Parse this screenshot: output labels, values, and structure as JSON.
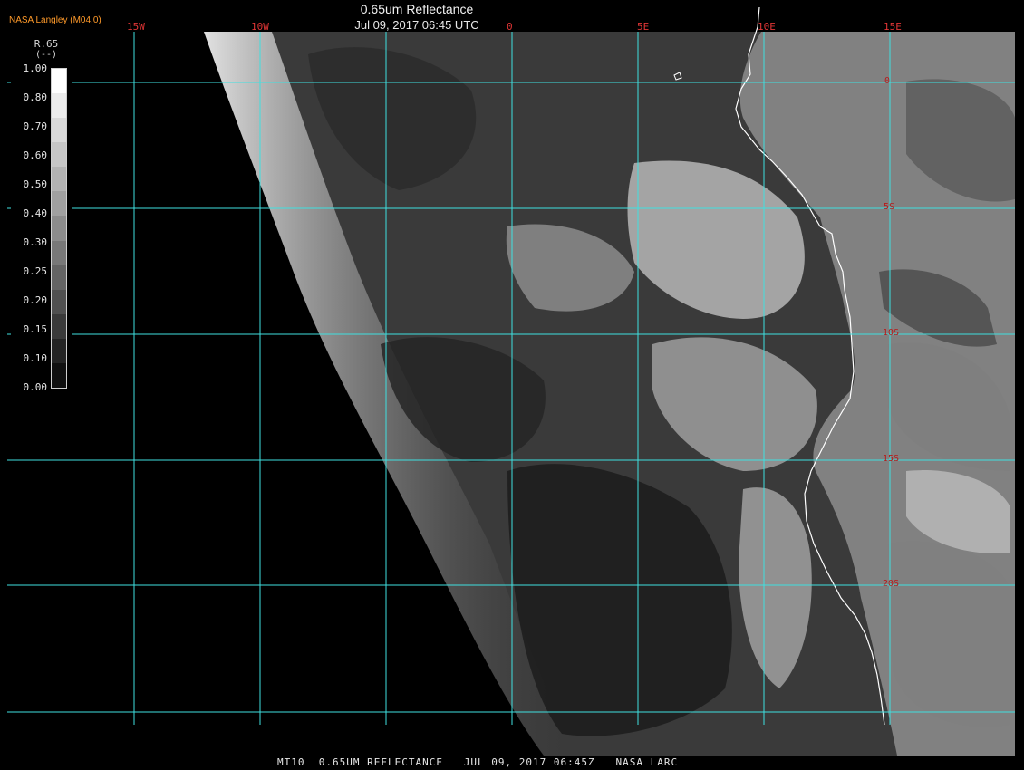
{
  "header": {
    "source": "NASA Langley (M04.0)",
    "title": "0.65um Reflectance",
    "timestamp": "Jul 09, 2017 06:45 UTC"
  },
  "legend": {
    "title": "R.65",
    "units": "(--)",
    "ticks": [
      "1.00",
      "0.80",
      "0.70",
      "0.60",
      "0.50",
      "0.40",
      "0.30",
      "0.25",
      "0.20",
      "0.15",
      "0.10",
      "0.00"
    ],
    "swatch_colors": [
      "#ffffff",
      "#ececec",
      "#d9d9d9",
      "#c6c6c6",
      "#b3b3b3",
      "#a0a0a0",
      "#8c8c8c",
      "#787878",
      "#646464",
      "#505050",
      "#3a3a3a",
      "#242424",
      "#101010"
    ]
  },
  "grid": {
    "longitudes": [
      "15W",
      "10W",
      "0",
      "5E",
      "10E",
      "15E"
    ],
    "latitudes": [
      "0",
      "5S",
      "10S",
      "15S",
      "20S"
    ],
    "line_color": "#3fe0e0"
  },
  "footer": {
    "text": "MT10  0.65UM REFLECTANCE   JUL 09, 2017 06:45Z   NASA LARC"
  },
  "colors": {
    "background": "#000000",
    "source_label": "#ff9a2a",
    "lon_label": "#e03535",
    "lat_label": "#b81a1a",
    "coastline": "#ffffff"
  }
}
